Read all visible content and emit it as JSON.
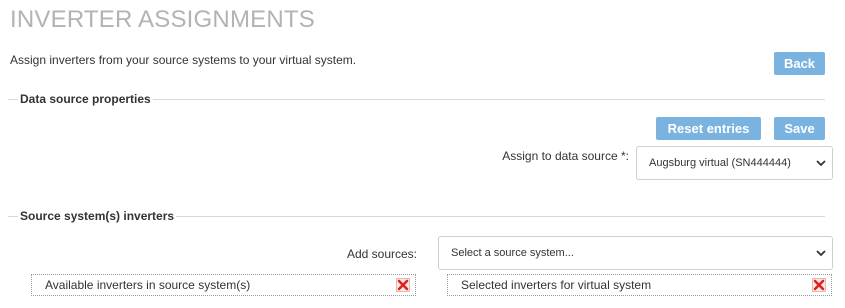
{
  "page": {
    "title": "INVERTER ASSIGNMENTS",
    "intro": "Assign inverters from your source systems to your virtual system."
  },
  "toolbar": {
    "back_label": "Back",
    "reset_label": "Reset entries",
    "save_label": "Save"
  },
  "data_source": {
    "section_title": "Data source properties",
    "assign_label": "Assign to data source *:",
    "assign_value": "Augsburg virtual (SN444444)"
  },
  "sources": {
    "section_title": "Source system(s) inverters",
    "add_label": "Add sources:",
    "add_value": "Select a source system...",
    "available_title": "Available inverters in source system(s)",
    "selected_title": "Selected inverters for virtual system"
  },
  "colors": {
    "button": "#7ab3e0",
    "title": "#b3b3b3",
    "remove_icon": "#d9231d"
  },
  "icons": {
    "dropdown": "chevron-down-icon",
    "remove": "red-x-icon"
  }
}
